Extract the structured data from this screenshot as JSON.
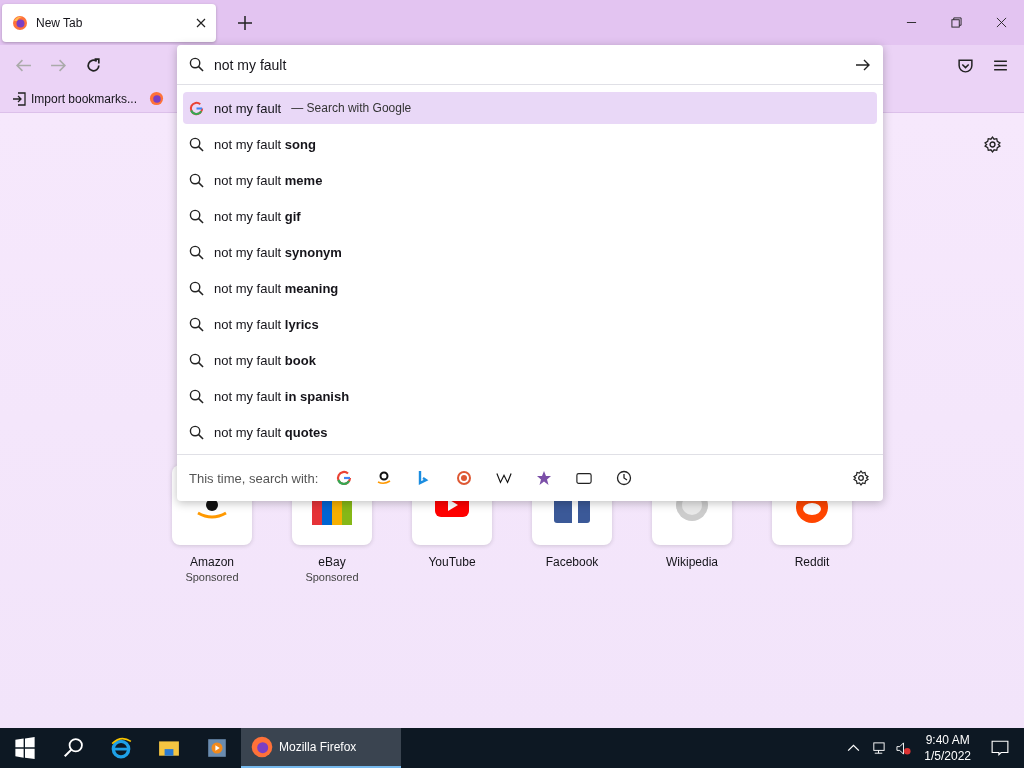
{
  "tab": {
    "title": "New Tab",
    "selected": true
  },
  "bookmarks": [
    {
      "label": "Import bookmarks..."
    }
  ],
  "urlbar": {
    "value": "not my fault"
  },
  "suggestions": [
    {
      "kind": "engine",
      "text": "not my fault",
      "action": "— Search with Google",
      "selected": true
    },
    {
      "kind": "search",
      "text": "not my fault **song**",
      "selected": false
    },
    {
      "kind": "search",
      "text": "not my fault **meme**",
      "selected": false
    },
    {
      "kind": "search",
      "text": "not my fault **gif**",
      "selected": false
    },
    {
      "kind": "search",
      "text": "not my fault **synonym**",
      "selected": false
    },
    {
      "kind": "search",
      "text": "not my fault **meaning**",
      "selected": false
    },
    {
      "kind": "search",
      "text": "not my fault **lyrics**",
      "selected": false
    },
    {
      "kind": "search",
      "text": "not my fault **book**",
      "selected": false
    },
    {
      "kind": "search",
      "text": "not my fault **in spanish**",
      "selected": false
    },
    {
      "kind": "search",
      "text": "not my fault **quotes**",
      "selected": false
    }
  ],
  "search_with": {
    "label": "This time, search with:"
  },
  "top_sites": [
    {
      "name": "Amazon",
      "note": "Sponsored"
    },
    {
      "name": "eBay",
      "note": "Sponsored"
    },
    {
      "name": "YouTube"
    },
    {
      "name": "Facebook"
    },
    {
      "name": "Wikipedia"
    },
    {
      "name": "Reddit"
    }
  ],
  "taskbar": {
    "app": "Mozilla Firefox",
    "time": "9:40 AM",
    "date": "1/5/2022"
  }
}
